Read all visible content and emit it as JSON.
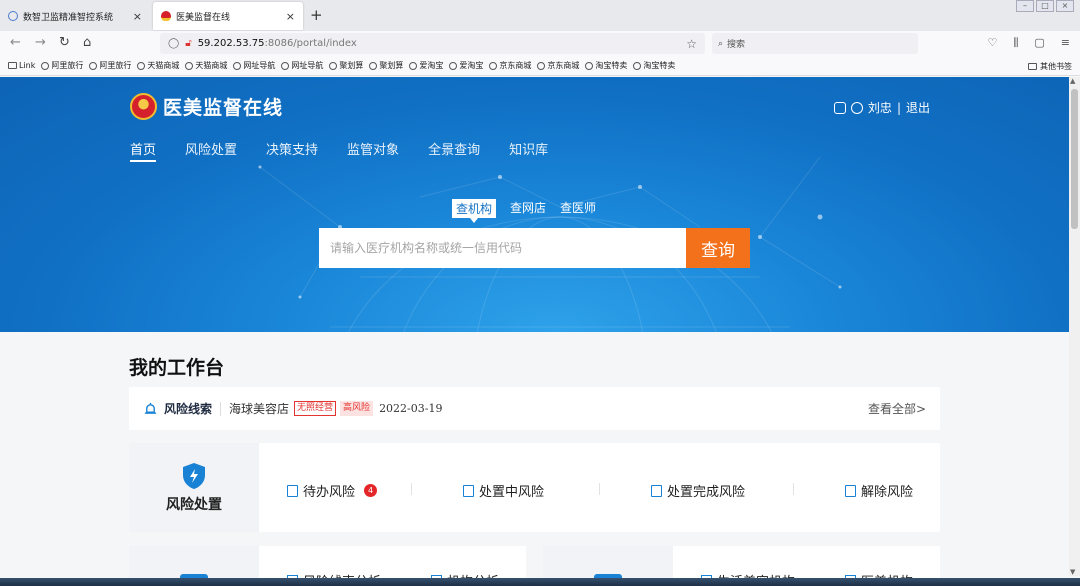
{
  "browser": {
    "tabs": [
      {
        "label": "数智卫监精准智控系统",
        "close": "×"
      },
      {
        "label": "医美监督在线",
        "close": "×"
      }
    ],
    "new_tab": "+",
    "url_host": "59.202.53.75",
    "url_path": ":8086/portal/index",
    "search_placeholder": "搜索",
    "bookmarks": [
      "Link",
      "阿里旅行",
      "阿里旅行",
      "天猫商城",
      "天猫商城",
      "网址导航",
      "网址导航",
      "聚划算",
      "聚划算",
      "爱淘宝",
      "爱淘宝",
      "京东商城",
      "京东商城",
      "淘宝特卖",
      "淘宝特卖"
    ],
    "other_bookmarks": "其他书签"
  },
  "site": {
    "title": "医美监督在线",
    "user_name": "刘忠",
    "logout": "退出",
    "user_sep": "|",
    "nav": [
      "首页",
      "风险处置",
      "决策支持",
      "监管对象",
      "全景查询",
      "知识库"
    ],
    "search_tabs": [
      "查机构",
      "查网店",
      "查医师"
    ],
    "search_placeholder": "请输入医疗机构名称或统一信用代码",
    "search_button": "查询"
  },
  "workbench": {
    "title": "我的工作台",
    "clue": {
      "label": "风险线索",
      "name": "海球美容店",
      "tag1": "无照经营",
      "tag2": "高风险",
      "date": "2022-03-19",
      "view_all": "查看全部>"
    },
    "risk": {
      "label": "风险处置",
      "items": [
        "待办风险",
        "处置中风险",
        "处置完成风险",
        "解除风险"
      ],
      "pending_count": "4"
    },
    "card2_items": [
      "风险线索分析",
      "机构分析"
    ],
    "card3_items": [
      "生活美容机构",
      "医美机构"
    ]
  },
  "colors": {
    "accent": "#1a82d4",
    "search_button": "#f3711b",
    "danger": "#e3262a"
  }
}
